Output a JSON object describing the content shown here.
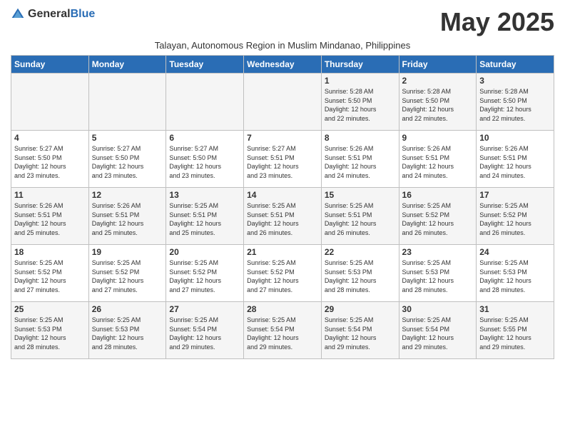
{
  "header": {
    "logo_general": "General",
    "logo_blue": "Blue",
    "month_title": "May 2025",
    "subtitle": "Talayan, Autonomous Region in Muslim Mindanao, Philippines"
  },
  "days_of_week": [
    "Sunday",
    "Monday",
    "Tuesday",
    "Wednesday",
    "Thursday",
    "Friday",
    "Saturday"
  ],
  "weeks": [
    [
      {
        "day": "",
        "info": ""
      },
      {
        "day": "",
        "info": ""
      },
      {
        "day": "",
        "info": ""
      },
      {
        "day": "",
        "info": ""
      },
      {
        "day": "1",
        "info": "Sunrise: 5:28 AM\nSunset: 5:50 PM\nDaylight: 12 hours\nand 22 minutes."
      },
      {
        "day": "2",
        "info": "Sunrise: 5:28 AM\nSunset: 5:50 PM\nDaylight: 12 hours\nand 22 minutes."
      },
      {
        "day": "3",
        "info": "Sunrise: 5:28 AM\nSunset: 5:50 PM\nDaylight: 12 hours\nand 22 minutes."
      }
    ],
    [
      {
        "day": "4",
        "info": "Sunrise: 5:27 AM\nSunset: 5:50 PM\nDaylight: 12 hours\nand 23 minutes."
      },
      {
        "day": "5",
        "info": "Sunrise: 5:27 AM\nSunset: 5:50 PM\nDaylight: 12 hours\nand 23 minutes."
      },
      {
        "day": "6",
        "info": "Sunrise: 5:27 AM\nSunset: 5:50 PM\nDaylight: 12 hours\nand 23 minutes."
      },
      {
        "day": "7",
        "info": "Sunrise: 5:27 AM\nSunset: 5:51 PM\nDaylight: 12 hours\nand 23 minutes."
      },
      {
        "day": "8",
        "info": "Sunrise: 5:26 AM\nSunset: 5:51 PM\nDaylight: 12 hours\nand 24 minutes."
      },
      {
        "day": "9",
        "info": "Sunrise: 5:26 AM\nSunset: 5:51 PM\nDaylight: 12 hours\nand 24 minutes."
      },
      {
        "day": "10",
        "info": "Sunrise: 5:26 AM\nSunset: 5:51 PM\nDaylight: 12 hours\nand 24 minutes."
      }
    ],
    [
      {
        "day": "11",
        "info": "Sunrise: 5:26 AM\nSunset: 5:51 PM\nDaylight: 12 hours\nand 25 minutes."
      },
      {
        "day": "12",
        "info": "Sunrise: 5:26 AM\nSunset: 5:51 PM\nDaylight: 12 hours\nand 25 minutes."
      },
      {
        "day": "13",
        "info": "Sunrise: 5:25 AM\nSunset: 5:51 PM\nDaylight: 12 hours\nand 25 minutes."
      },
      {
        "day": "14",
        "info": "Sunrise: 5:25 AM\nSunset: 5:51 PM\nDaylight: 12 hours\nand 26 minutes."
      },
      {
        "day": "15",
        "info": "Sunrise: 5:25 AM\nSunset: 5:51 PM\nDaylight: 12 hours\nand 26 minutes."
      },
      {
        "day": "16",
        "info": "Sunrise: 5:25 AM\nSunset: 5:52 PM\nDaylight: 12 hours\nand 26 minutes."
      },
      {
        "day": "17",
        "info": "Sunrise: 5:25 AM\nSunset: 5:52 PM\nDaylight: 12 hours\nand 26 minutes."
      }
    ],
    [
      {
        "day": "18",
        "info": "Sunrise: 5:25 AM\nSunset: 5:52 PM\nDaylight: 12 hours\nand 27 minutes."
      },
      {
        "day": "19",
        "info": "Sunrise: 5:25 AM\nSunset: 5:52 PM\nDaylight: 12 hours\nand 27 minutes."
      },
      {
        "day": "20",
        "info": "Sunrise: 5:25 AM\nSunset: 5:52 PM\nDaylight: 12 hours\nand 27 minutes."
      },
      {
        "day": "21",
        "info": "Sunrise: 5:25 AM\nSunset: 5:52 PM\nDaylight: 12 hours\nand 27 minutes."
      },
      {
        "day": "22",
        "info": "Sunrise: 5:25 AM\nSunset: 5:53 PM\nDaylight: 12 hours\nand 28 minutes."
      },
      {
        "day": "23",
        "info": "Sunrise: 5:25 AM\nSunset: 5:53 PM\nDaylight: 12 hours\nand 28 minutes."
      },
      {
        "day": "24",
        "info": "Sunrise: 5:25 AM\nSunset: 5:53 PM\nDaylight: 12 hours\nand 28 minutes."
      }
    ],
    [
      {
        "day": "25",
        "info": "Sunrise: 5:25 AM\nSunset: 5:53 PM\nDaylight: 12 hours\nand 28 minutes."
      },
      {
        "day": "26",
        "info": "Sunrise: 5:25 AM\nSunset: 5:53 PM\nDaylight: 12 hours\nand 28 minutes."
      },
      {
        "day": "27",
        "info": "Sunrise: 5:25 AM\nSunset: 5:54 PM\nDaylight: 12 hours\nand 29 minutes."
      },
      {
        "day": "28",
        "info": "Sunrise: 5:25 AM\nSunset: 5:54 PM\nDaylight: 12 hours\nand 29 minutes."
      },
      {
        "day": "29",
        "info": "Sunrise: 5:25 AM\nSunset: 5:54 PM\nDaylight: 12 hours\nand 29 minutes."
      },
      {
        "day": "30",
        "info": "Sunrise: 5:25 AM\nSunset: 5:54 PM\nDaylight: 12 hours\nand 29 minutes."
      },
      {
        "day": "31",
        "info": "Sunrise: 5:25 AM\nSunset: 5:55 PM\nDaylight: 12 hours\nand 29 minutes."
      }
    ]
  ]
}
